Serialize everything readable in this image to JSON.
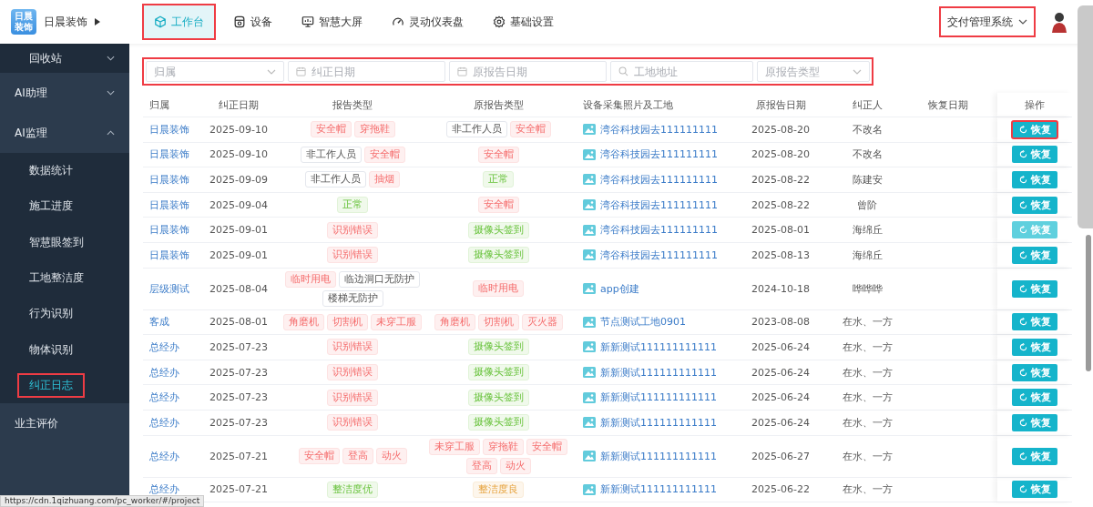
{
  "brand": {
    "logo_lines": [
      "日晨",
      "装饰"
    ],
    "name": "日晨装饰"
  },
  "nav_tabs": [
    {
      "label": "工作台",
      "selected": true,
      "highlighted": true
    },
    {
      "label": "设备",
      "selected": false,
      "highlighted": false
    },
    {
      "label": "智慧大屏",
      "selected": false,
      "highlighted": false
    },
    {
      "label": "灵动仪表盘",
      "selected": false,
      "highlighted": false
    },
    {
      "label": "基础设置",
      "selected": false,
      "highlighted": false
    }
  ],
  "system_switch": {
    "label": "交付管理系统",
    "highlighted": true
  },
  "sidebar": {
    "items": [
      {
        "label": "回收站",
        "kind": "menu",
        "expanded": false
      },
      {
        "label": "AI助理",
        "kind": "menu",
        "expanded": false
      },
      {
        "label": "AI监理",
        "kind": "menu",
        "expanded": true,
        "children": [
          {
            "label": "数据统计",
            "selected": false,
            "highlighted": false
          },
          {
            "label": "施工进度",
            "selected": false,
            "highlighted": false
          },
          {
            "label": "智慧眼签到",
            "selected": false,
            "highlighted": false
          },
          {
            "label": "工地整洁度",
            "selected": false,
            "highlighted": false
          },
          {
            "label": "行为识别",
            "selected": false,
            "highlighted": false
          },
          {
            "label": "物体识别",
            "selected": false,
            "highlighted": false
          },
          {
            "label": "纠正日志",
            "selected": true,
            "highlighted": true
          }
        ]
      },
      {
        "label": "业主评价",
        "kind": "link"
      }
    ]
  },
  "filters": {
    "highlighted": true,
    "fields": [
      {
        "placeholder": "归属",
        "kind": "select"
      },
      {
        "placeholder": "纠正日期",
        "kind": "date"
      },
      {
        "placeholder": "原报告日期",
        "kind": "date"
      },
      {
        "placeholder": "工地地址",
        "kind": "search"
      },
      {
        "placeholder": "原报告类型",
        "kind": "select"
      }
    ]
  },
  "table": {
    "columns": [
      "归属",
      "纠正日期",
      "报告类型",
      "原报告类型",
      "设备采集照片及工地",
      "原报告日期",
      "纠正人",
      "恢复日期",
      "操作"
    ],
    "rows": [
      {
        "owner": "日晨装饰",
        "date": "2025-09-10",
        "report_tags": [
          {
            "text": "安全帽",
            "kind": "danger"
          },
          {
            "text": "穿拖鞋",
            "kind": "danger"
          }
        ],
        "orig_tags": [
          {
            "text": "非工作人员",
            "kind": "plain"
          },
          {
            "text": "安全帽",
            "kind": "danger"
          }
        ],
        "site": "湾谷科技园去111111111",
        "orig_date": "2025-08-20",
        "corrector": "不改名",
        "action": {
          "label": "恢复",
          "disabled": false,
          "highlighted": true
        }
      },
      {
        "owner": "日晨装饰",
        "date": "2025-09-10",
        "report_tags": [
          {
            "text": "非工作人员",
            "kind": "plain"
          },
          {
            "text": "安全帽",
            "kind": "danger"
          }
        ],
        "orig_tags": [
          {
            "text": "安全帽",
            "kind": "danger"
          }
        ],
        "site": "湾谷科技园去111111111",
        "orig_date": "2025-08-20",
        "corrector": "不改名",
        "action": {
          "label": "恢复",
          "disabled": false,
          "highlighted": false
        }
      },
      {
        "owner": "日晨装饰",
        "date": "2025-09-09",
        "report_tags": [
          {
            "text": "非工作人员",
            "kind": "plain"
          },
          {
            "text": "抽烟",
            "kind": "danger"
          }
        ],
        "orig_tags": [
          {
            "text": "正常",
            "kind": "success"
          }
        ],
        "site": "湾谷科技园去111111111",
        "orig_date": "2025-08-22",
        "corrector": "陈建安",
        "action": {
          "label": "恢复",
          "disabled": false,
          "highlighted": false
        }
      },
      {
        "owner": "日晨装饰",
        "date": "2025-09-04",
        "report_tags": [
          {
            "text": "正常",
            "kind": "success"
          }
        ],
        "orig_tags": [
          {
            "text": "安全帽",
            "kind": "danger"
          }
        ],
        "site": "湾谷科技园去111111111",
        "orig_date": "2025-08-22",
        "corrector": "曾阶",
        "action": {
          "label": "恢复",
          "disabled": false,
          "highlighted": false
        }
      },
      {
        "owner": "日晨装饰",
        "date": "2025-09-01",
        "report_tags": [
          {
            "text": "识别错误",
            "kind": "danger"
          }
        ],
        "orig_tags": [
          {
            "text": "摄像头签到",
            "kind": "success"
          }
        ],
        "site": "湾谷科技园去111111111",
        "orig_date": "2025-08-01",
        "corrector": "海绵丘",
        "action": {
          "label": "恢复",
          "disabled": true,
          "highlighted": false
        }
      },
      {
        "owner": "日晨装饰",
        "date": "2025-09-01",
        "report_tags": [
          {
            "text": "识别错误",
            "kind": "danger"
          }
        ],
        "orig_tags": [
          {
            "text": "摄像头签到",
            "kind": "success"
          }
        ],
        "site": "湾谷科技园去111111111",
        "orig_date": "2025-08-13",
        "corrector": "海绵丘",
        "action": {
          "label": "恢复",
          "disabled": false,
          "highlighted": false
        }
      },
      {
        "owner": "层级测试",
        "date": "2025-08-04",
        "report_tags": [
          {
            "text": "临时用电",
            "kind": "danger"
          },
          {
            "text": "临边洞口无防护",
            "kind": "plain"
          },
          {
            "text": "楼梯无防护",
            "kind": "plain"
          }
        ],
        "orig_tags": [
          {
            "text": "临时用电",
            "kind": "danger"
          }
        ],
        "site": "app创建",
        "orig_date": "2024-10-18",
        "corrector": "哗哗哗",
        "action": {
          "label": "恢复",
          "disabled": false,
          "highlighted": false
        }
      },
      {
        "owner": "客成",
        "date": "2025-08-01",
        "report_tags": [
          {
            "text": "角磨机",
            "kind": "danger"
          },
          {
            "text": "切割机",
            "kind": "danger"
          },
          {
            "text": "未穿工服",
            "kind": "danger"
          }
        ],
        "orig_tags": [
          {
            "text": "角磨机",
            "kind": "danger"
          },
          {
            "text": "切割机",
            "kind": "danger"
          },
          {
            "text": "灭火器",
            "kind": "danger"
          }
        ],
        "site": "节点测试工地0901",
        "orig_date": "2023-08-08",
        "corrector": "在水、一方",
        "action": {
          "label": "恢复",
          "disabled": false,
          "highlighted": false
        }
      },
      {
        "owner": "总经办",
        "date": "2025-07-23",
        "report_tags": [
          {
            "text": "识别错误",
            "kind": "danger"
          }
        ],
        "orig_tags": [
          {
            "text": "摄像头签到",
            "kind": "success"
          }
        ],
        "site": "新新测试111111111111",
        "orig_date": "2025-06-24",
        "corrector": "在水、一方",
        "action": {
          "label": "恢复",
          "disabled": false,
          "highlighted": false
        }
      },
      {
        "owner": "总经办",
        "date": "2025-07-23",
        "report_tags": [
          {
            "text": "识别错误",
            "kind": "danger"
          }
        ],
        "orig_tags": [
          {
            "text": "摄像头签到",
            "kind": "success"
          }
        ],
        "site": "新新测试111111111111",
        "orig_date": "2025-06-24",
        "corrector": "在水、一方",
        "action": {
          "label": "恢复",
          "disabled": false,
          "highlighted": false
        }
      },
      {
        "owner": "总经办",
        "date": "2025-07-23",
        "report_tags": [
          {
            "text": "识别错误",
            "kind": "danger"
          }
        ],
        "orig_tags": [
          {
            "text": "摄像头签到",
            "kind": "success"
          }
        ],
        "site": "新新测试111111111111",
        "orig_date": "2025-06-24",
        "corrector": "在水、一方",
        "action": {
          "label": "恢复",
          "disabled": false,
          "highlighted": false
        }
      },
      {
        "owner": "总经办",
        "date": "2025-07-23",
        "report_tags": [
          {
            "text": "识别错误",
            "kind": "danger"
          }
        ],
        "orig_tags": [
          {
            "text": "摄像头签到",
            "kind": "success"
          }
        ],
        "site": "新新测试111111111111",
        "orig_date": "2025-06-24",
        "corrector": "在水、一方",
        "action": {
          "label": "恢复",
          "disabled": false,
          "highlighted": false
        }
      },
      {
        "owner": "总经办",
        "date": "2025-07-21",
        "report_tags": [
          {
            "text": "安全帽",
            "kind": "danger"
          },
          {
            "text": "登高",
            "kind": "danger"
          },
          {
            "text": "动火",
            "kind": "danger"
          }
        ],
        "orig_tags": [
          {
            "text": "未穿工服",
            "kind": "danger"
          },
          {
            "text": "穿拖鞋",
            "kind": "danger"
          },
          {
            "text": "安全帽",
            "kind": "danger"
          },
          {
            "text": "登高",
            "kind": "danger"
          },
          {
            "text": "动火",
            "kind": "danger"
          }
        ],
        "site": "新新测试111111111111",
        "orig_date": "2025-06-27",
        "corrector": "在水、一方",
        "action": {
          "label": "恢复",
          "disabled": false,
          "highlighted": false
        }
      },
      {
        "owner": "总经办",
        "date": "2025-07-21",
        "report_tags": [
          {
            "text": "整洁度优",
            "kind": "success"
          }
        ],
        "orig_tags": [
          {
            "text": "整洁度良",
            "kind": "warning"
          }
        ],
        "site": "新新测试111111111111",
        "orig_date": "2025-06-22",
        "corrector": "在水、一方",
        "action": {
          "label": "恢复",
          "disabled": false,
          "highlighted": false
        }
      }
    ]
  },
  "status_bar": {
    "url": "https://cdn.1qizhuang.com/pc_worker/#/project"
  }
}
